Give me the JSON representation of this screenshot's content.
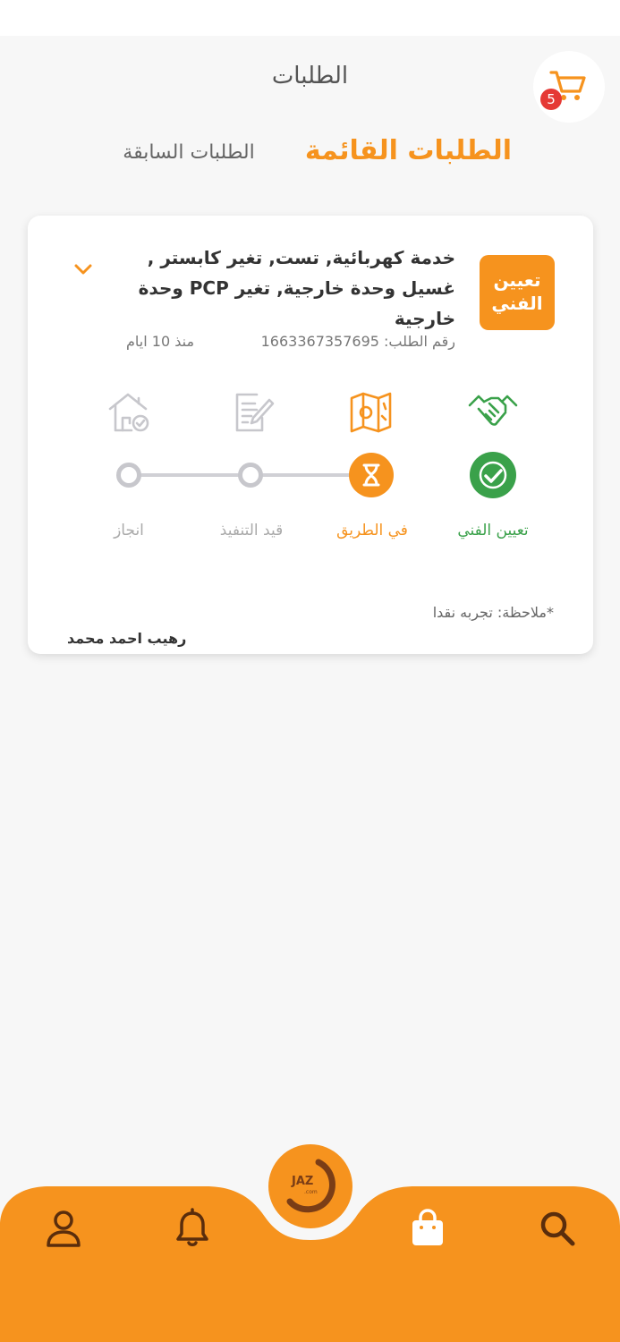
{
  "header": {
    "title": "الطلبات",
    "cart_count": "5"
  },
  "tabs": {
    "current": "الطلبات القائمة",
    "previous": "الطلبات السابقة"
  },
  "order": {
    "status_chip": "تعيين الفني",
    "service_title": "خدمة كهربائية, تست, تغير كابستر , غسيل وحدة خارجية, تغير PCP وحدة خارجية",
    "order_number": "رقم الطلب: 1663367357695",
    "age": "منذ 10 ايام",
    "steps": [
      {
        "label": "تعيين الفني",
        "state": "done",
        "icon": "handshake-icon"
      },
      {
        "label": "في الطريق",
        "state": "active",
        "icon": "map-icon"
      },
      {
        "label": "قيد التنفيذ",
        "state": "pending",
        "icon": "document-edit-icon"
      },
      {
        "label": "انجاز",
        "state": "pending",
        "icon": "house-check-icon"
      }
    ],
    "note": "*ملاحظة: تجربه نقدا",
    "technician": "رهيب احمد محمد"
  },
  "nav": {
    "logo_text": "JAZ",
    "logo_sub": ".com",
    "items": [
      "search-icon",
      "shopping-bag-icon",
      "bell-icon",
      "user-icon"
    ]
  },
  "colors": {
    "accent": "#f6931e",
    "done": "#3aa14a",
    "pending": "#c7c7cc",
    "badge": "#e53935"
  }
}
